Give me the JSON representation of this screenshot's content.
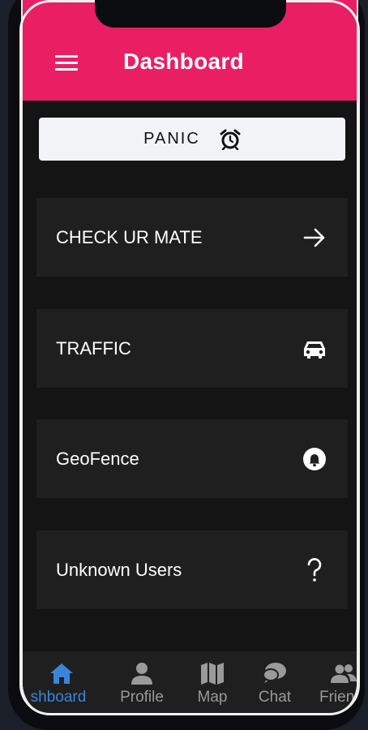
{
  "header": {
    "title": "Dashboard"
  },
  "panic": {
    "label": "PANIC",
    "icon": "alarm-clock-icon"
  },
  "cards": [
    {
      "label": "CHECK UR MATE",
      "icon": "arrow-right-icon"
    },
    {
      "label": "TRAFFIC",
      "icon": "car-icon"
    },
    {
      "label": "GeoFence",
      "icon": "bell-icon"
    },
    {
      "label": "Unknown Users",
      "icon": "question-icon"
    }
  ],
  "bottom_nav": {
    "items": [
      {
        "label": "Dashboard",
        "visible_text": "shboard",
        "icon": "home-icon",
        "active": true
      },
      {
        "label": "Profile",
        "icon": "person-icon"
      },
      {
        "label": "Map",
        "icon": "map-icon"
      },
      {
        "label": "Chat",
        "icon": "chat-icon"
      },
      {
        "label": "Friends",
        "visible_text": "Frien",
        "icon": "friends-icon"
      }
    ]
  },
  "colors": {
    "appbar": "#e91e63",
    "background": "#141414",
    "card": "#1f1f1f",
    "active_nav": "#3a86d6",
    "inactive_nav": "#9a9a9a"
  }
}
